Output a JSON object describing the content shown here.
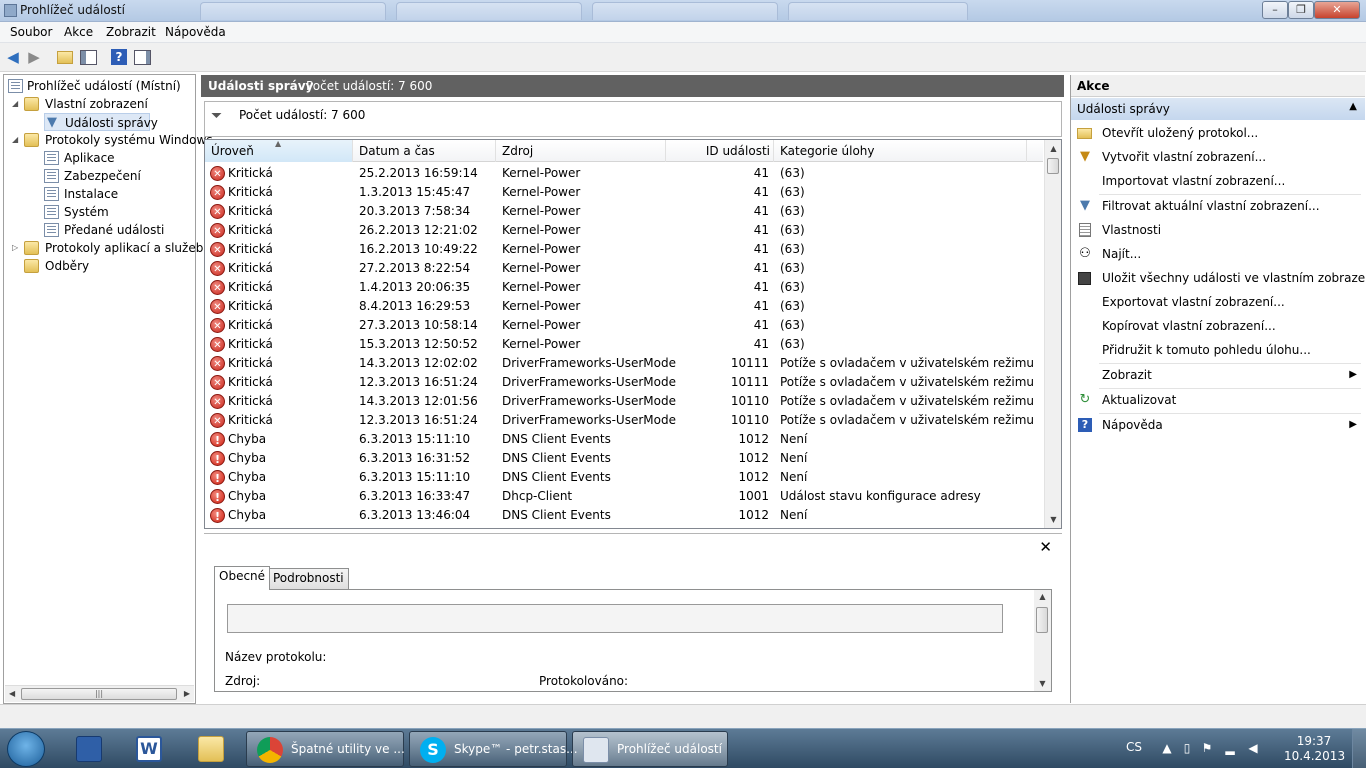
{
  "window": {
    "title": "Prohlížeč událostí"
  },
  "menu": [
    "Soubor",
    "Akce",
    "Zobrazit",
    "Nápověda"
  ],
  "tree": {
    "root": "Prohlížeč událostí (Místní)",
    "custom_views": "Vlastní zobrazení",
    "admin_events": "Události správy",
    "windows_logs": "Protokoly systému Windows",
    "logs": [
      "Aplikace",
      "Zabezpečení",
      "Instalace",
      "Systém",
      "Předané události"
    ],
    "app_logs": "Protokoly aplikací a služeb",
    "subscriptions": "Odběry"
  },
  "center": {
    "title": "Události správy",
    "count_header": "Počet událostí: 7 600",
    "count_bar": "Počet událostí: 7 600"
  },
  "grid": {
    "columns": [
      "Úroveň",
      "Datum a čas",
      "Zdroj",
      "ID události",
      "Kategorie úlohy"
    ],
    "rows": [
      {
        "level": "Kritická",
        "type": "crit",
        "dt": "25.2.2013 16:59:14",
        "src": "Kernel-Power",
        "id": "41",
        "cat": "(63)"
      },
      {
        "level": "Kritická",
        "type": "crit",
        "dt": "1.3.2013 15:45:47",
        "src": "Kernel-Power",
        "id": "41",
        "cat": "(63)"
      },
      {
        "level": "Kritická",
        "type": "crit",
        "dt": "20.3.2013 7:58:34",
        "src": "Kernel-Power",
        "id": "41",
        "cat": "(63)"
      },
      {
        "level": "Kritická",
        "type": "crit",
        "dt": "26.2.2013 12:21:02",
        "src": "Kernel-Power",
        "id": "41",
        "cat": "(63)"
      },
      {
        "level": "Kritická",
        "type": "crit",
        "dt": "16.2.2013 10:49:22",
        "src": "Kernel-Power",
        "id": "41",
        "cat": "(63)"
      },
      {
        "level": "Kritická",
        "type": "crit",
        "dt": "27.2.2013 8:22:54",
        "src": "Kernel-Power",
        "id": "41",
        "cat": "(63)"
      },
      {
        "level": "Kritická",
        "type": "crit",
        "dt": "1.4.2013 20:06:35",
        "src": "Kernel-Power",
        "id": "41",
        "cat": "(63)"
      },
      {
        "level": "Kritická",
        "type": "crit",
        "dt": "8.4.2013 16:29:53",
        "src": "Kernel-Power",
        "id": "41",
        "cat": "(63)"
      },
      {
        "level": "Kritická",
        "type": "crit",
        "dt": "27.3.2013 10:58:14",
        "src": "Kernel-Power",
        "id": "41",
        "cat": "(63)"
      },
      {
        "level": "Kritická",
        "type": "crit",
        "dt": "15.3.2013 12:50:52",
        "src": "Kernel-Power",
        "id": "41",
        "cat": "(63)"
      },
      {
        "level": "Kritická",
        "type": "crit",
        "dt": "14.3.2013 12:02:02",
        "src": "DriverFrameworks-UserMode",
        "id": "10111",
        "cat": "Potíže s ovladačem v uživatelském režimu"
      },
      {
        "level": "Kritická",
        "type": "crit",
        "dt": "12.3.2013 16:51:24",
        "src": "DriverFrameworks-UserMode",
        "id": "10111",
        "cat": "Potíže s ovladačem v uživatelském režimu"
      },
      {
        "level": "Kritická",
        "type": "crit",
        "dt": "14.3.2013 12:01:56",
        "src": "DriverFrameworks-UserMode",
        "id": "10110",
        "cat": "Potíže s ovladačem v uživatelském režimu"
      },
      {
        "level": "Kritická",
        "type": "crit",
        "dt": "12.3.2013 16:51:24",
        "src": "DriverFrameworks-UserMode",
        "id": "10110",
        "cat": "Potíže s ovladačem v uživatelském režimu"
      },
      {
        "level": "Chyba",
        "type": "err",
        "dt": "6.3.2013 15:11:10",
        "src": "DNS Client Events",
        "id": "1012",
        "cat": "Není"
      },
      {
        "level": "Chyba",
        "type": "err",
        "dt": "6.3.2013 16:31:52",
        "src": "DNS Client Events",
        "id": "1012",
        "cat": "Není"
      },
      {
        "level": "Chyba",
        "type": "err",
        "dt": "6.3.2013 15:11:10",
        "src": "DNS Client Events",
        "id": "1012",
        "cat": "Není"
      },
      {
        "level": "Chyba",
        "type": "err",
        "dt": "6.3.2013 16:33:47",
        "src": "Dhcp-Client",
        "id": "1001",
        "cat": "Událost stavu konfigurace adresy"
      },
      {
        "level": "Chyba",
        "type": "err",
        "dt": "6.3.2013 13:46:04",
        "src": "DNS Client Events",
        "id": "1012",
        "cat": "Není"
      }
    ]
  },
  "detail": {
    "tabs": [
      "Obecné",
      "Podrobnosti"
    ],
    "log_name_label": "Název protokolu:",
    "source_label": "Zdroj:",
    "logged_label": "Protokolováno:"
  },
  "actions": {
    "header": "Akce",
    "section": "Události správy",
    "items": [
      "Otevřít uložený protokol...",
      "Vytvořit vlastní zobrazení...",
      "Importovat vlastní zobrazení...",
      "Filtrovat aktuální vlastní zobrazení...",
      "Vlastnosti",
      "Najít...",
      "Uložit všechny události ve vlastním zobraze...",
      "Exportovat vlastní zobrazení...",
      "Kopírovat vlastní zobrazení...",
      "Přidružit k tomuto pohledu úlohu...",
      "Zobrazit",
      "Aktualizovat",
      "Nápověda"
    ]
  },
  "taskbar": {
    "tasks": [
      "Špatné utility ve ...",
      "Skype™ - petr.stas...",
      "Prohlížeč událostí"
    ],
    "lang": "CS",
    "time": "19:37",
    "date": "10.4.2013"
  },
  "colors": {
    "header_dark": "#616161",
    "critical": "#c8261c",
    "selection": "#dde8f6"
  }
}
